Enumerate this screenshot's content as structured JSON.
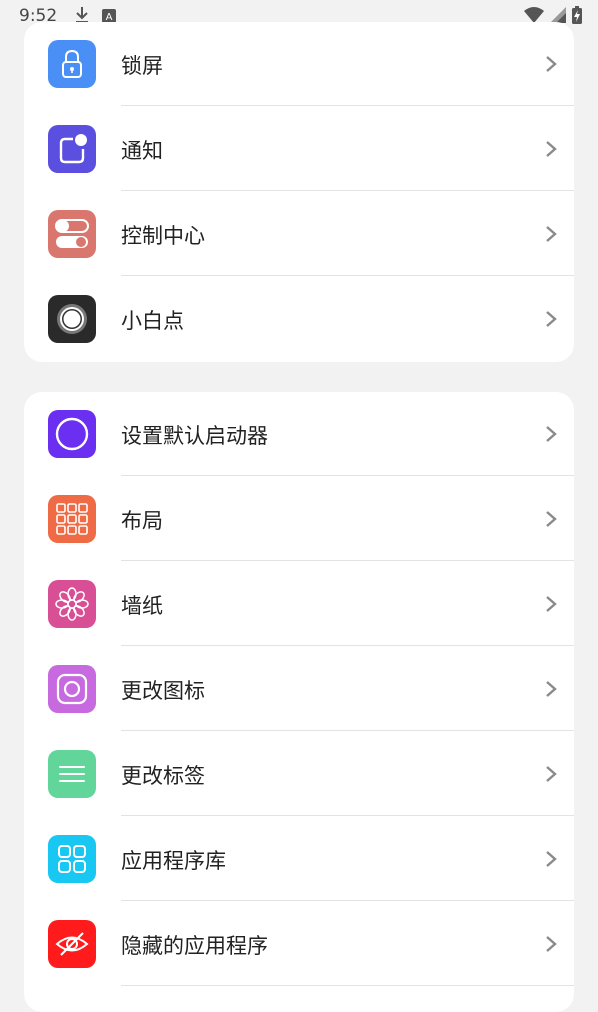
{
  "status_bar": {
    "time": "9:52",
    "left_icons": [
      "download-icon",
      "a-badge-icon"
    ],
    "right_icons": [
      "wifi-icon",
      "signal-icon",
      "battery-charging-icon"
    ]
  },
  "section1": {
    "items": [
      {
        "label": "锁屏",
        "icon": "lock-icon",
        "color": "#4a8ff5"
      },
      {
        "label": "通知",
        "icon": "notification-icon",
        "color": "#5b4fe0"
      },
      {
        "label": "控制中心",
        "icon": "toggle-switch-icon",
        "color": "#d9776f"
      },
      {
        "label": "小白点",
        "icon": "assistive-touch-icon",
        "color": "#2a2a2a"
      }
    ]
  },
  "section2": {
    "items": [
      {
        "label": "设置默认启动器",
        "icon": "circle-launcher-icon",
        "color": "#6a2ff0"
      },
      {
        "label": "布局",
        "icon": "grid-layout-icon",
        "color": "#ef6b45"
      },
      {
        "label": "墙纸",
        "icon": "flower-wallpaper-icon",
        "color": "#d94f95"
      },
      {
        "label": "更改图标",
        "icon": "instagram-square-icon",
        "color": "#c86adf"
      },
      {
        "label": "更改标签",
        "icon": "menu-lines-icon",
        "color": "#61d59a"
      },
      {
        "label": "应用程序库",
        "icon": "app-library-icon",
        "color": "#18c8f2"
      },
      {
        "label": "隐藏的应用程序",
        "icon": "eye-hidden-icon",
        "color": "#ff1b1b"
      }
    ]
  }
}
